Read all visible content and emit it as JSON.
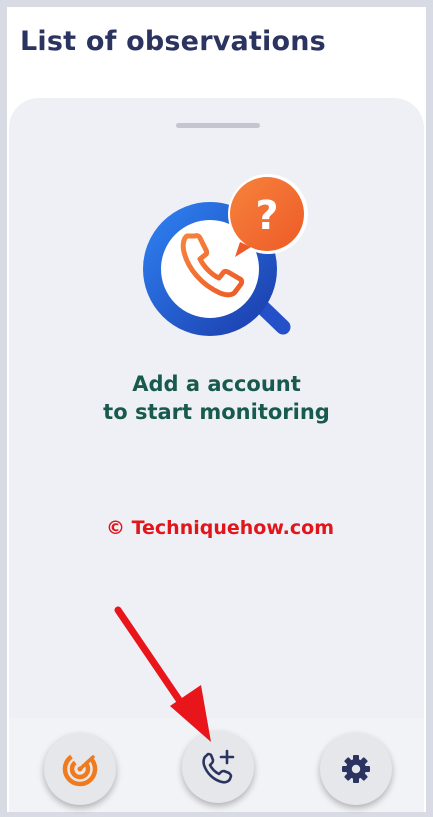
{
  "header": {
    "title": "List of observations"
  },
  "empty_state": {
    "line1": "Add a account",
    "line2": "to start monitoring",
    "illustration_icon": "phone-search-question-icon"
  },
  "watermark": {
    "text": "© Techniquehow.com"
  },
  "bottom_nav": {
    "items": [
      {
        "icon": "radar-icon",
        "color": "#f07a1e"
      },
      {
        "icon": "add-call-icon",
        "color": "#2b3460"
      },
      {
        "icon": "gear-icon",
        "color": "#2b3460"
      }
    ]
  },
  "colors": {
    "title": "#2b3460",
    "message": "#185a4e",
    "watermark": "#e0161b",
    "sheet_background": "#eff0f5",
    "annotation_arrow": "#e8151b"
  }
}
